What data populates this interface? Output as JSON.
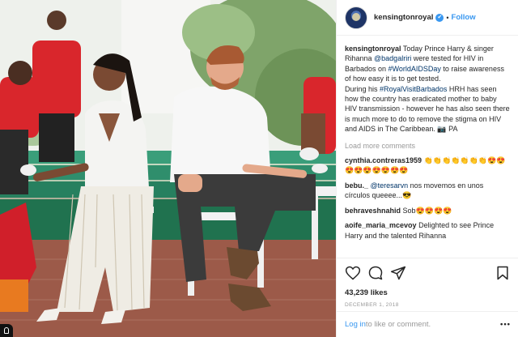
{
  "post": {
    "username": "kensingtonroyal",
    "verified_glyph": "✔",
    "separator": "•",
    "follow_label": "Follow",
    "caption": {
      "username": "kensingtonroyal",
      "part1": " Today Prince Harry & singer Rihanna ",
      "mention": "@badgalriri",
      "part2": " were tested for HIV in Barbados on ",
      "hashtag1": "#WorldAIDSDay",
      "part3": " to raise awareness of how easy it is to get tested.",
      "part4": "During his ",
      "hashtag2": "#RoyalVisitBarbados",
      "part5": " HRH has seen how the country has eradicated mother to baby HIV transmission - however he has also seen there is much more to do to remove the stigma on HIV and AIDS in The Caribbean. 📷 PA"
    },
    "load_more_label": "Load more comments",
    "comments": [
      {
        "username": "cynthia.contreras1959",
        "text": " 👏👏👏👏👏👏👏😍😍😍😍😍😍😍😍😍"
      },
      {
        "username": "bebu._",
        "mention": " @teresarvn",
        "text": " nos movemos en unos círculos queeee...😎"
      },
      {
        "username": "behraveshnahid",
        "text": " Sob😍😍😍😍"
      },
      {
        "username": "aoife_maria_mcevoy",
        "text": " Delighted to see Prince Harry and the talented Rihanna"
      }
    ],
    "likes": "43,239 likes",
    "date": "December 1, 2018",
    "login": {
      "link": "Log in",
      "rest": " to like or comment.",
      "more_glyph": "•••"
    }
  },
  "icons": [
    "heart-icon",
    "comment-icon",
    "share-icon",
    "bookmark-icon",
    "camera-icon"
  ],
  "colors": {
    "link": "#3897f0",
    "tag": "#003569",
    "muted": "#999999",
    "text": "#262626"
  }
}
